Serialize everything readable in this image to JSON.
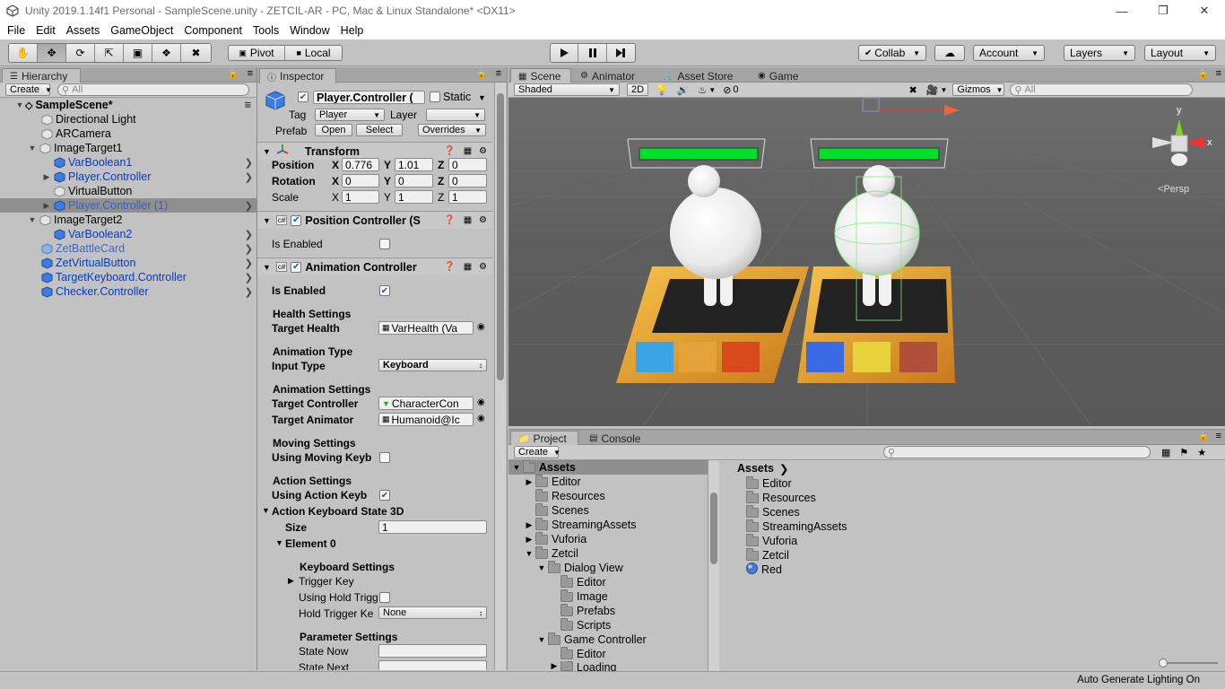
{
  "window": {
    "title": "Unity 2019.1.14f1 Personal - SampleScene.unity - ZETCIL-AR - PC, Mac & Linux Standalone* <DX11>"
  },
  "menu": [
    "File",
    "Edit",
    "Assets",
    "GameObject",
    "Component",
    "Tools",
    "Window",
    "Help"
  ],
  "toolbar": {
    "pivot_label": "Pivot",
    "local_label": "Local",
    "collab_label": "Collab",
    "account_label": "Account",
    "layers_label": "Layers",
    "layout_label": "Layout"
  },
  "hierarchy": {
    "tab": "Hierarchy",
    "create": "Create",
    "search_placeholder": "All",
    "scene": "SampleScene*",
    "items": [
      {
        "label": "Directional Light"
      },
      {
        "label": "ARCamera"
      },
      {
        "label": "ImageTarget1"
      },
      {
        "label": "VarBoolean1"
      },
      {
        "label": "Player.Controller"
      },
      {
        "label": "VirtualButton"
      },
      {
        "label": "Player.Controller (1)"
      },
      {
        "label": "ImageTarget2"
      },
      {
        "label": "VarBoolean2"
      },
      {
        "label": "ZetBattleCard"
      },
      {
        "label": "ZetVirtualButton"
      },
      {
        "label": "TargetKeyboard.Controller"
      },
      {
        "label": "Checker.Controller"
      }
    ]
  },
  "inspector": {
    "tab": "Inspector",
    "object_name": "Player.Controller (",
    "static_label": "Static",
    "tag_label": "Tag",
    "tag_value": "Player",
    "layer_label": "Layer",
    "prefab_label": "Prefab",
    "open_label": "Open",
    "select_label": "Select",
    "overrides_label": "Overrides",
    "transform": {
      "title": "Transform",
      "position_label": "Position",
      "rotation_label": "Rotation",
      "scale_label": "Scale",
      "x_label": "X",
      "y_label": "Y",
      "z_label": "Z",
      "position": [
        "0.776",
        "1.01",
        "0"
      ],
      "rotation": [
        "0",
        "0",
        "0"
      ],
      "scale": [
        "1",
        "1",
        "1"
      ]
    },
    "position_controller": {
      "title": "Position Controller (S",
      "is_enabled_label": "Is Enabled"
    },
    "animation_controller": {
      "title": "Animation Controller",
      "is_enabled_label": "Is Enabled",
      "health_settings": "Health Settings",
      "target_health_label": "Target Health",
      "target_health_value": "VarHealth (Va",
      "animation_type": "Animation Type",
      "input_type_label": "Input Type",
      "input_type_value": "Keyboard",
      "animation_settings": "Animation Settings",
      "target_controller_label": "Target Controller",
      "target_controller_value": "CharacterCon",
      "target_animator_label": "Target Animator",
      "target_animator_value": "Humanoid@Ic",
      "moving_settings": "Moving Settings",
      "using_moving_label": "Using Moving Keyb",
      "action_settings": "Action Settings",
      "using_action_label": "Using Action Keyb",
      "action_keyboard_label": "Action Keyboard State 3D",
      "size_label": "Size",
      "size_value": "1",
      "element_label": "Element 0",
      "keyboard_settings": "Keyboard Settings",
      "trigger_key_label": "Trigger Key",
      "using_hold_label": "Using Hold Trigg",
      "hold_trigger_label": "Hold Trigger Ke",
      "hold_trigger_value": "None",
      "parameter_settings": "Parameter Settings",
      "state_now_label": "State Now",
      "state_next_label": "State Next"
    }
  },
  "scene": {
    "tabs": [
      "Scene",
      "Animator",
      "Asset Store",
      "Game"
    ],
    "shading": "Shaded",
    "mode_2d": "2D",
    "hidden_count": "0",
    "gizmos_label": "Gizmos",
    "search_placeholder": "All",
    "persp_label": "Persp",
    "axis_y": "y",
    "axis_x": "x"
  },
  "project": {
    "tabs": [
      "Project",
      "Console"
    ],
    "create": "Create",
    "tree": [
      {
        "label": "Assets",
        "depth": 0,
        "arrow": "open"
      },
      {
        "label": "Editor",
        "depth": 1,
        "arrow": "closed"
      },
      {
        "label": "Resources",
        "depth": 1,
        "arrow": ""
      },
      {
        "label": "Scenes",
        "depth": 1,
        "arrow": ""
      },
      {
        "label": "StreamingAssets",
        "depth": 1,
        "arrow": "closed"
      },
      {
        "label": "Vuforia",
        "depth": 1,
        "arrow": "closed"
      },
      {
        "label": "Zetcil",
        "depth": 1,
        "arrow": "open"
      },
      {
        "label": "Dialog View",
        "depth": 2,
        "arrow": "open"
      },
      {
        "label": "Editor",
        "depth": 3,
        "arrow": ""
      },
      {
        "label": "Image",
        "depth": 3,
        "arrow": ""
      },
      {
        "label": "Prefabs",
        "depth": 3,
        "arrow": ""
      },
      {
        "label": "Scripts",
        "depth": 3,
        "arrow": ""
      },
      {
        "label": "Game Controller",
        "depth": 2,
        "arrow": "open"
      },
      {
        "label": "Editor",
        "depth": 3,
        "arrow": ""
      },
      {
        "label": "Loading",
        "depth": 3,
        "arrow": "closed"
      }
    ],
    "breadcrumb": "Assets",
    "contents": [
      "Editor",
      "Resources",
      "Scenes",
      "StreamingAssets",
      "Vuforia",
      "Zetcil",
      "Red"
    ]
  },
  "status": {
    "text": "Auto Generate Lighting On"
  },
  "colors": {
    "panel": "#c2c2c2",
    "tab_strip": "#a5a5a5",
    "selection": "#8f8f8f",
    "link_blue": "#0a3bb0",
    "health_green": "#00e02a"
  }
}
